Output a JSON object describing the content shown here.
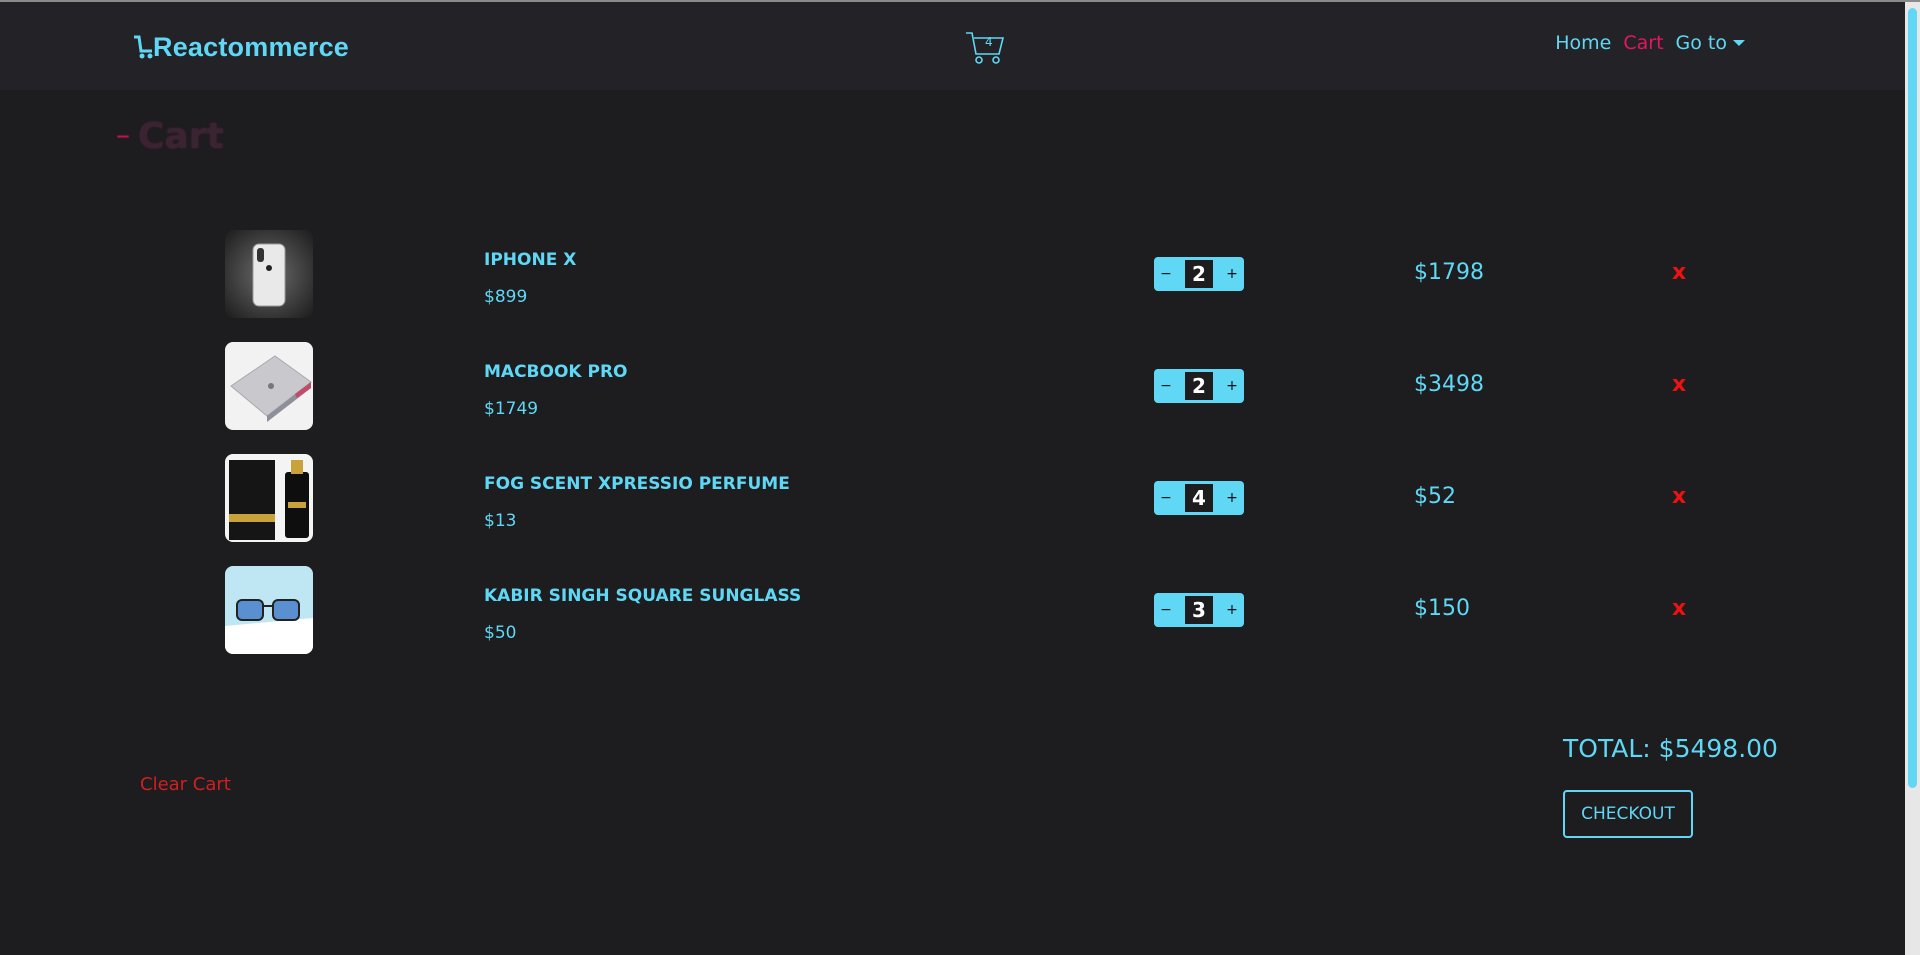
{
  "brand": {
    "name": "Reactommerce",
    "logo_icon": "cart-icon"
  },
  "nav": {
    "cart_count": "4",
    "links": [
      {
        "label": "Home"
      },
      {
        "label": "Cart",
        "active": true
      },
      {
        "label": "Go to",
        "dropdown": true
      }
    ]
  },
  "page": {
    "title": "Cart",
    "title_prefix": "–"
  },
  "cart": {
    "items": [
      {
        "name": "IPHONE X",
        "price": "$899",
        "quantity": "2",
        "line_total": "$1798",
        "remove_label": "x",
        "image": "iphone-x-image"
      },
      {
        "name": "MACBOOK PRO",
        "price": "$1749",
        "quantity": "2",
        "line_total": "$3498",
        "remove_label": "x",
        "image": "macbook-pro-image"
      },
      {
        "name": "FOG SCENT XPRESSIO PERFUME",
        "price": "$13",
        "quantity": "4",
        "line_total": "$52",
        "remove_label": "x",
        "image": "perfume-image"
      },
      {
        "name": "KABIR SINGH SQUARE SUNGLASS",
        "price": "$50",
        "quantity": "3",
        "line_total": "$150",
        "remove_label": "x",
        "image": "sunglass-image"
      }
    ],
    "decrement_label": "−",
    "increment_label": "+"
  },
  "footer": {
    "clear_label": "Clear Cart",
    "total_label": "TOTAL: $5498.00",
    "checkout_label": "CHECKOUT"
  },
  "colors": {
    "accent": "#5fd7f5",
    "active_link": "#e6155f",
    "danger": "#e11111",
    "background": "#1d1d20"
  }
}
